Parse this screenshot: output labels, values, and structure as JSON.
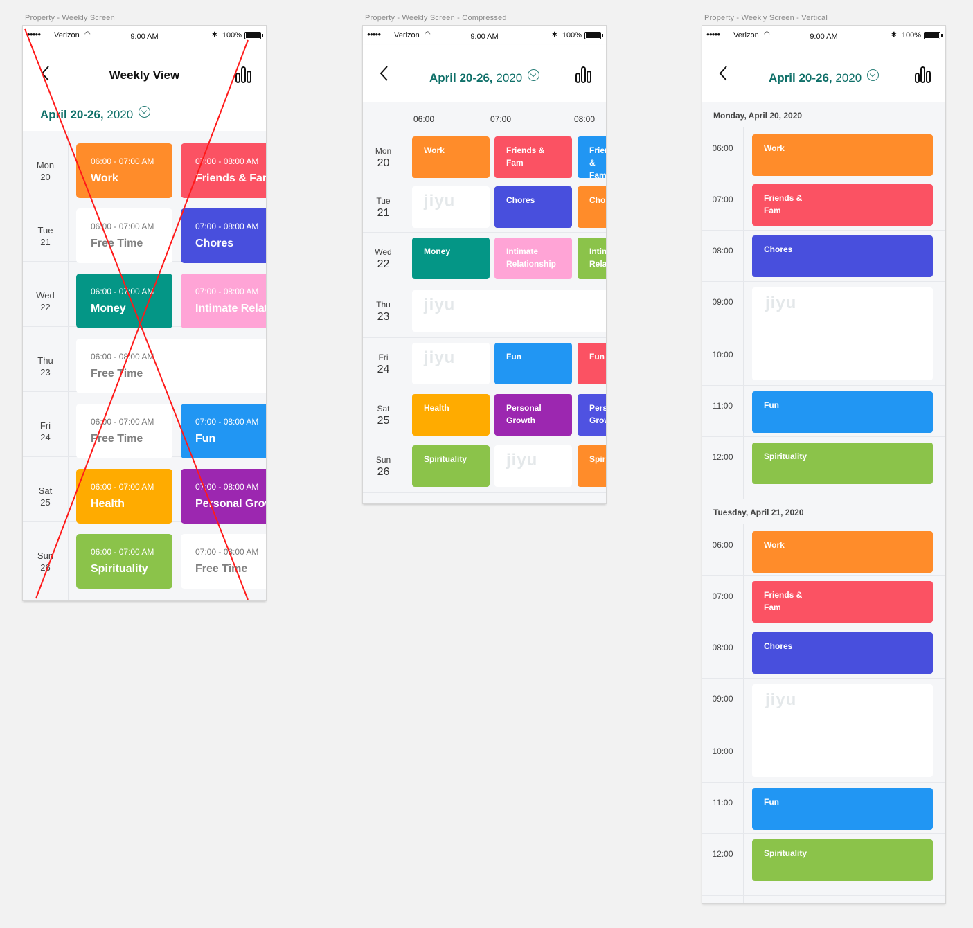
{
  "status": {
    "carrier": "Verizon",
    "time": "9:00 AM",
    "battery": "100%"
  },
  "colors": {
    "work": "#ff8c2a",
    "friends": "#fb5263",
    "chores": "#484fdd",
    "money": "#049686",
    "intimate": "#ffa4d6",
    "intimate2": "#8bc34a",
    "fun": "#2196f3",
    "health": "#ffab00",
    "growth": "#9c27b0",
    "growth2": "#4f52e1",
    "spirituality": "#8bc34a",
    "accent": "#0e6f68"
  },
  "frame1": {
    "caption": "Property - Weekly Screen",
    "title": "Weekly View",
    "range_bold": "April 20-26,",
    "range_year": " 2020",
    "days": [
      {
        "name": "Mon",
        "date": "20",
        "cards": [
          {
            "time": "06:00 - 07:00 AM",
            "label": "Work",
            "color": "#ff8c2a"
          },
          {
            "time": "07:00 - 08:00 AM",
            "label": "Friends & Fam",
            "color": "#fb5263"
          }
        ]
      },
      {
        "name": "Tue",
        "date": "21",
        "cards": [
          {
            "time": "06:00 - 07:00 AM",
            "label": "Free Time",
            "free": true
          },
          {
            "time": "07:00 - 08:00 AM",
            "label": "Chores",
            "color": "#484fdd"
          }
        ]
      },
      {
        "name": "Wed",
        "date": "22",
        "cards": [
          {
            "time": "06:00 - 07:00 AM",
            "label": "Money",
            "color": "#049686"
          },
          {
            "time": "07:00 - 08:00 AM",
            "label": "Intimate Relationship",
            "color": "#ffa4d6"
          }
        ]
      },
      {
        "name": "Thu",
        "date": "23",
        "cards": [
          {
            "time": "06:00 - 08:00 AM",
            "label": "Free Time",
            "free": true,
            "wide": true
          }
        ]
      },
      {
        "name": "Fri",
        "date": "24",
        "cards": [
          {
            "time": "06:00 - 07:00 AM",
            "label": "Free Time",
            "free": true
          },
          {
            "time": "07:00 - 08:00 AM",
            "label": "Fun",
            "color": "#2196f3"
          }
        ]
      },
      {
        "name": "Sat",
        "date": "25",
        "cards": [
          {
            "time": "06:00 - 07:00 AM",
            "label": "Health",
            "color": "#ffab00"
          },
          {
            "time": "07:00 - 08:00 AM",
            "label": "Personal Growth",
            "color": "#9c27b0"
          }
        ]
      },
      {
        "name": "Sun",
        "date": "26",
        "cards": [
          {
            "time": "06:00 - 07:00 AM",
            "label": "Spirituality",
            "color": "#8bc34a"
          },
          {
            "time": "07:00 - 08:00 AM",
            "label": "Free Time",
            "free": true
          }
        ]
      }
    ]
  },
  "frame2": {
    "caption": "Property - Weekly Screen - Compressed",
    "range_bold": "April 20-26,",
    "range_year": " 2020",
    "hours": [
      "06:00",
      "07:00",
      "08:00"
    ],
    "logo": "jiyu",
    "days": [
      {
        "name": "Mon",
        "date": "20",
        "cards": [
          {
            "label": "Work",
            "color": "#ff8c2a"
          },
          {
            "label": "Friends &\nFam",
            "color": "#fb5263"
          },
          {
            "label": "Friends &\nFam",
            "color": "#2196f3"
          }
        ]
      },
      {
        "name": "Tue",
        "date": "21",
        "cards": [
          {
            "free": true
          },
          {
            "label": "Chores",
            "color": "#484fdd"
          },
          {
            "label": "Chores",
            "color": "#ff8c2a"
          }
        ]
      },
      {
        "name": "Wed",
        "date": "22",
        "cards": [
          {
            "label": "Money",
            "color": "#049686"
          },
          {
            "label": "Intimate\nRelationship",
            "color": "#ffa4d6"
          },
          {
            "label": "Intimate\nRelationship",
            "color": "#8bc34a"
          }
        ]
      },
      {
        "name": "Thu",
        "date": "23",
        "cards": [
          {
            "free": true,
            "wide": true
          }
        ]
      },
      {
        "name": "Fri",
        "date": "24",
        "cards": [
          {
            "free": true
          },
          {
            "label": "Fun",
            "color": "#2196f3"
          },
          {
            "label": "Fun",
            "color": "#fb5263"
          }
        ]
      },
      {
        "name": "Sat",
        "date": "25",
        "cards": [
          {
            "label": "Health",
            "color": "#ffab00"
          },
          {
            "label": "Personal\nGrowth",
            "color": "#9c27b0"
          },
          {
            "label": "Personal\nGrowth",
            "color": "#4f52e1"
          }
        ]
      },
      {
        "name": "Sun",
        "date": "26",
        "cards": [
          {
            "label": "Spirituality",
            "color": "#8bc34a"
          },
          {
            "free": true
          },
          {
            "label": "Spirituality",
            "color": "#ff8c2a"
          }
        ]
      }
    ]
  },
  "frame3": {
    "caption": "Property - Weekly Screen - Vertical",
    "range_bold": "April 20-26,",
    "range_year": " 2020",
    "logo": "jiyu",
    "sections": [
      {
        "title": "Monday, April 20, 2020",
        "times": [
          "06:00",
          "07:00",
          "08:00",
          "09:00",
          "10:00",
          "11:00",
          "12:00"
        ],
        "cards": [
          {
            "label": "Work",
            "color": "#ff8c2a"
          },
          {
            "label": "Friends &\nFam",
            "color": "#fb5263"
          },
          {
            "label": "Chores",
            "color": "#484fdd"
          },
          {
            "free": true
          },
          {
            "label": "Fun",
            "color": "#2196f3"
          },
          {
            "label": "Spirituality",
            "color": "#8bc34a"
          }
        ]
      },
      {
        "title": "Tuesday, April 21, 2020",
        "times": [
          "06:00",
          "07:00",
          "08:00",
          "09:00",
          "10:00",
          "11:00",
          "12:00"
        ],
        "cards": [
          {
            "label": "Work",
            "color": "#ff8c2a"
          },
          {
            "label": "Friends &\nFam",
            "color": "#fb5263"
          },
          {
            "label": "Chores",
            "color": "#484fdd"
          },
          {
            "free": true
          },
          {
            "label": "Fun",
            "color": "#2196f3"
          },
          {
            "label": "Spirituality",
            "color": "#8bc34a"
          }
        ]
      }
    ]
  }
}
